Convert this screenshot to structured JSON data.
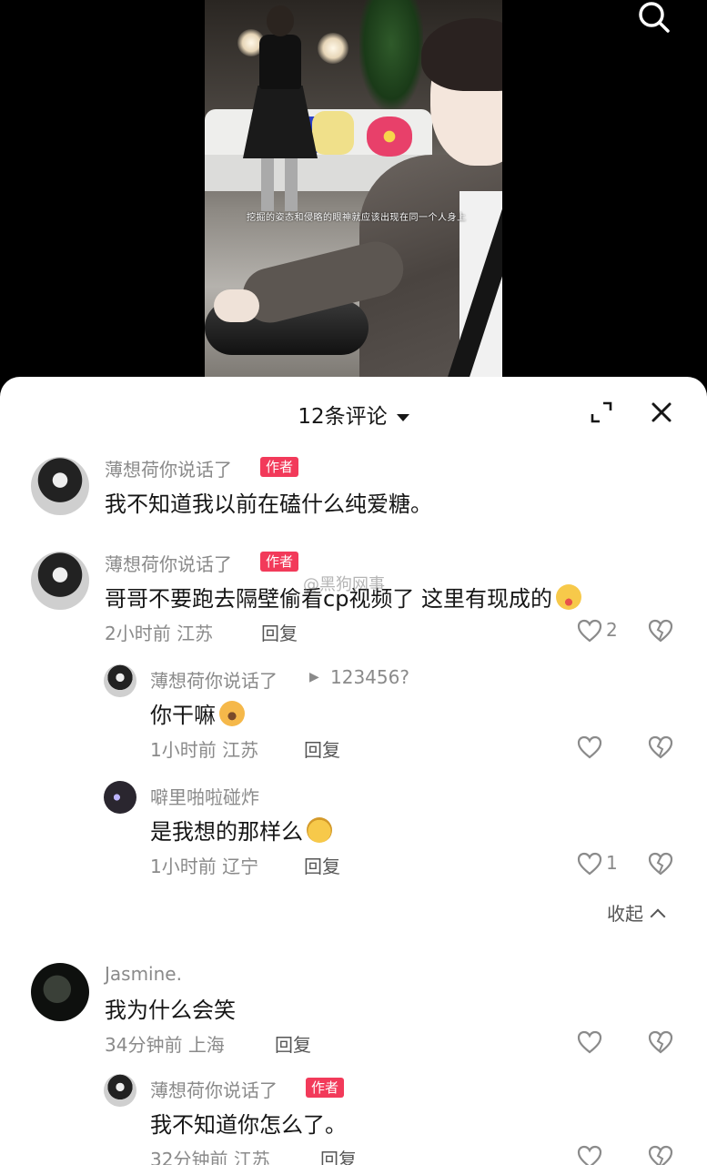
{
  "video": {
    "subtitle": "挖掘的姿态和侵略的眼神就应该出现在同一个人身上"
  },
  "sheet": {
    "comment_count_label": "12条评论",
    "author_tag": "作者",
    "reply_label": "回复",
    "collapse_label": "收起",
    "watermark": "@黑狗网事"
  },
  "comments": [
    {
      "username": "薄想荷你说话了",
      "text": "我不知道我以前在磕什么纯爱糖。"
    },
    {
      "username": "薄想荷你说话了",
      "text": "哥哥不要跑去隔壁偷看cp视频了 这里有现成的",
      "emoji": "face-with-tongue-emoji",
      "time": "2小时前",
      "location": "江苏",
      "likes": "2"
    },
    {
      "username": "Jasmine.",
      "text": "我为什么会笑",
      "time": "34分钟前",
      "location": "上海"
    }
  ],
  "replies": [
    {
      "username": "薄想荷你说话了",
      "reply_to": "123456?",
      "text": "你干嘛",
      "emoji": "bowing-face-emoji",
      "time": "1小时前",
      "location": "江苏"
    },
    {
      "username": "噼里啪啦碰炸",
      "text": "是我想的那样么",
      "emoji": "smirk-face-emoji",
      "time": "1小时前",
      "location": "辽宁",
      "likes": "1"
    },
    {
      "username": "薄想荷你说话了",
      "text": "我不知道你怎么了。",
      "time": "32分钟前",
      "location": "江苏"
    }
  ],
  "colors": {
    "author_tag": "#f23a5a",
    "secondary_text": "#8a8a8a",
    "primary_text": "#161616"
  }
}
